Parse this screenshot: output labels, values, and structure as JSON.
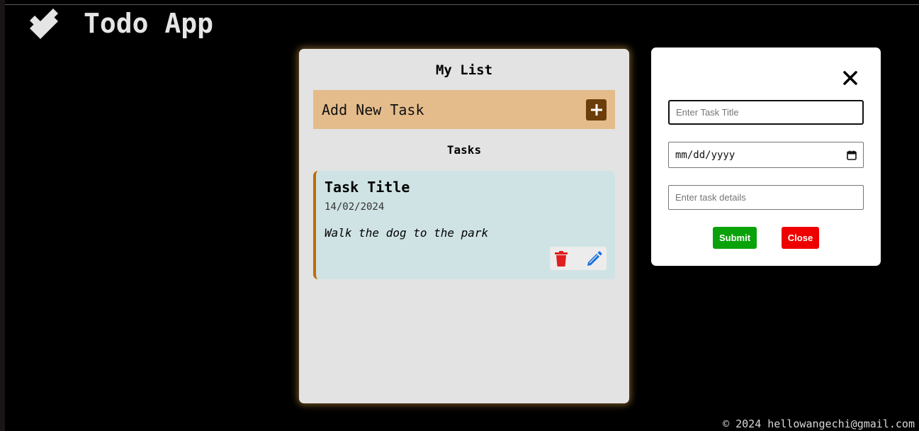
{
  "app": {
    "title": "Todo App",
    "logo_icon": "double-check-icon"
  },
  "list": {
    "title": "My List",
    "add_task_label": "Add New Task",
    "add_icon": "plus-icon",
    "tasks_heading": "Tasks",
    "tasks": [
      {
        "title": "Task Title",
        "date": "14/02/2024",
        "details": "Walk the dog to the park",
        "delete_icon": "trash-icon",
        "edit_icon": "pencil-icon"
      }
    ]
  },
  "modal": {
    "close_icon": "close-icon",
    "title_placeholder": "Enter Task Title",
    "date_placeholder": "mm/dd/yyyy",
    "details_placeholder": "Enter task details",
    "submit_label": "Submit",
    "close_label": "Close"
  },
  "footer": {
    "text": "© 2024 hellowangechi@gmail.com"
  },
  "colors": {
    "background": "#000000",
    "panel": "#e3e3e3",
    "add_bar": "#e4bc8b",
    "add_button": "#6b3d09",
    "task_card": "#cfe3e4",
    "task_accent": "#c26d00",
    "delete": "#e02020",
    "edit": "#1a6fd8",
    "submit": "#0aa20a",
    "close": "#ee0000"
  }
}
